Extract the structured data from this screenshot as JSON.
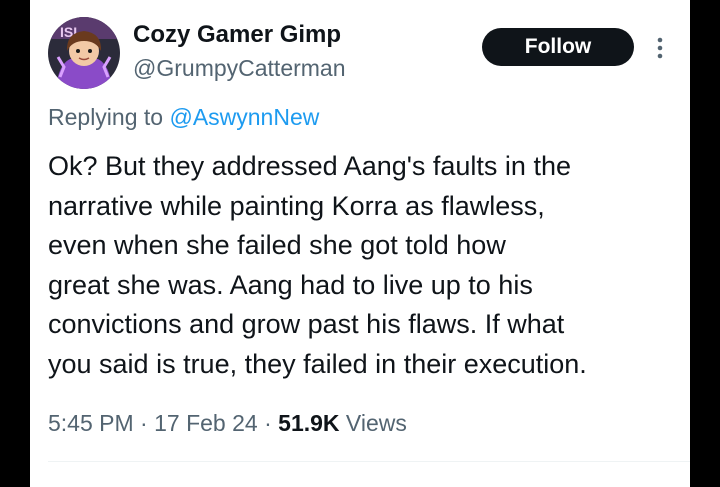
{
  "author": {
    "display_name": "Cozy Gamer Gimp",
    "handle": "@GrumpyCatterman",
    "avatar_icon": "cartoon-girl-avatar-icon"
  },
  "follow_button": {
    "label": "Follow"
  },
  "reply": {
    "prefix": "Replying to ",
    "handle": "@AswynnNew"
  },
  "tweet": {
    "lines": [
      "Ok? But they addressed Aang's faults in the",
      "narrative while painting Korra as flawless,",
      "even when she failed she got told how",
      "great she was. Aang had to live up to his",
      "convictions and grow past his flaws. If what",
      "you said is true, they failed in their execution."
    ]
  },
  "meta": {
    "time": "5:45 PM",
    "separator": " · ",
    "date": "17 Feb 24",
    "views_count": "51.9K",
    "views_label": " Views"
  },
  "colors": {
    "background": "#000000",
    "card": "#ffffff",
    "text_primary": "#0f1419",
    "text_secondary": "#536471",
    "link": "#1d9bf0",
    "button_bg": "#0f1419"
  }
}
